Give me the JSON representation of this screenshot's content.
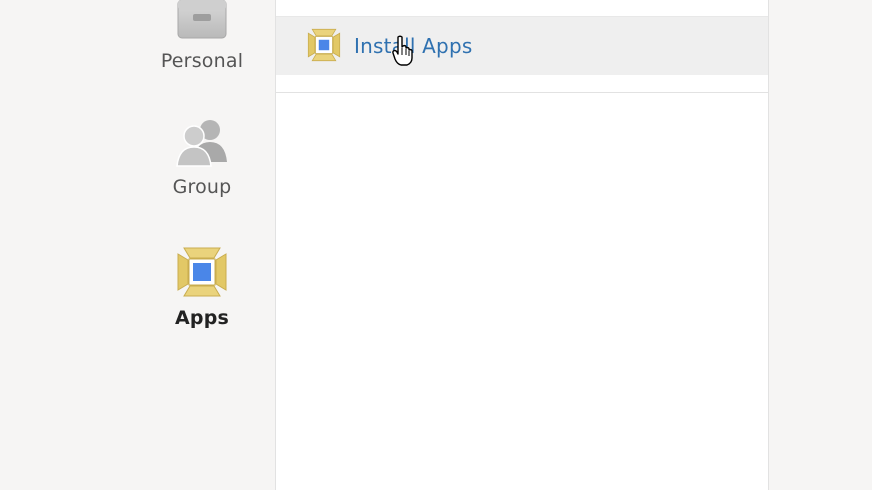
{
  "sidebar": {
    "items": [
      {
        "id": "personal",
        "label": "Personal",
        "icon": "personal-folder-icon",
        "active": false
      },
      {
        "id": "group",
        "label": "Group",
        "icon": "group-users-icon",
        "active": false
      },
      {
        "id": "apps",
        "label": "Apps",
        "icon": "apps-icon",
        "active": true
      }
    ]
  },
  "panel": {
    "rows": [
      {
        "label": "Install Apps",
        "icon": "apps-icon",
        "hovered": true
      }
    ]
  },
  "colors": {
    "link": "#2f71b0",
    "sidebar_bg": "#f6f5f4",
    "hover_row_bg": "#efefef",
    "apps_icon_frame": "#e8d27a",
    "apps_icon_screen": "#4a86e8"
  },
  "cursor": {
    "icon": "hand-pointer-icon"
  }
}
